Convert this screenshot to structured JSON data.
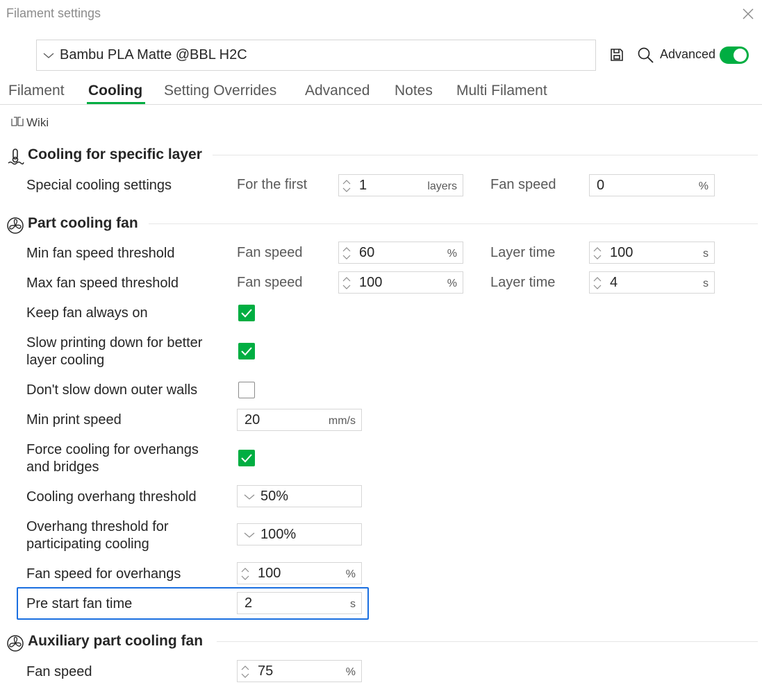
{
  "window": {
    "title": "Filament settings"
  },
  "header": {
    "preset_name": "Bambu PLA Matte @BBL H2C",
    "advanced_label": "Advanced",
    "advanced_on": true,
    "accent_color": "#00ae42"
  },
  "tabs": [
    {
      "label": "Filament",
      "active": false
    },
    {
      "label": "Cooling",
      "active": true
    },
    {
      "label": "Setting Overrides",
      "active": false
    },
    {
      "label": "Advanced",
      "active": false
    },
    {
      "label": "Notes",
      "active": false
    },
    {
      "label": "Multi Filament",
      "active": false
    }
  ],
  "wiki_label": "Wiki",
  "sections": {
    "specific_layer": {
      "title": "Cooling for specific layer",
      "special": {
        "label": "Special cooling settings",
        "first_label": "For the first",
        "first_value": "1",
        "first_unit": "layers",
        "fan_label": "Fan speed",
        "fan_value": "0",
        "fan_unit": "%"
      }
    },
    "part_fan": {
      "title": "Part cooling fan",
      "min_threshold": {
        "label": "Min fan speed threshold",
        "fan_label": "Fan speed",
        "fan_value": "60",
        "fan_unit": "%",
        "time_label": "Layer time",
        "time_value": "100",
        "time_unit": "s"
      },
      "max_threshold": {
        "label": "Max fan speed threshold",
        "fan_label": "Fan speed",
        "fan_value": "100",
        "fan_unit": "%",
        "time_label": "Layer time",
        "time_value": "4",
        "time_unit": "s"
      },
      "keep_fan_on": {
        "label": "Keep fan always on",
        "checked": true
      },
      "slow_down": {
        "label_line1": "Slow printing down for better",
        "label_line2": "layer cooling",
        "checked": true
      },
      "dont_slow_walls": {
        "label": "Don't slow down outer walls",
        "checked": false
      },
      "min_print_speed": {
        "label": "Min print speed",
        "value": "20",
        "unit": "mm/s"
      },
      "force_cooling": {
        "label_line1": "Force cooling for overhangs",
        "label_line2": "and bridges",
        "checked": true
      },
      "overhang_threshold": {
        "label": "Cooling overhang threshold",
        "value": "50%"
      },
      "participating_threshold": {
        "label_line1": "Overhang threshold for",
        "label_line2": "participating cooling",
        "value": "100%"
      },
      "overhang_fan": {
        "label": "Fan speed for overhangs",
        "value": "100",
        "unit": "%"
      },
      "pre_start": {
        "label": "Pre start fan time",
        "value": "2",
        "unit": "s"
      }
    },
    "aux_fan": {
      "title": "Auxiliary part cooling fan",
      "fan_speed": {
        "label": "Fan speed",
        "value": "75",
        "unit": "%"
      }
    }
  }
}
